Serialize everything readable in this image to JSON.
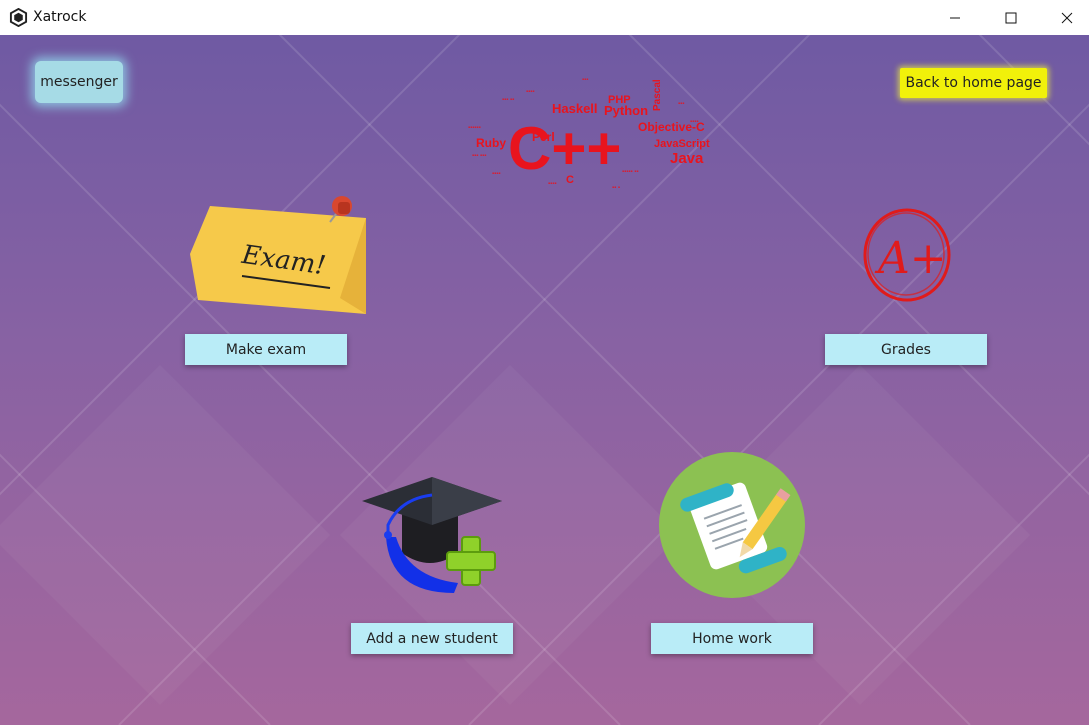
{
  "window": {
    "title": "Xatrock",
    "minimize_icon": "minimize-icon",
    "maximize_icon": "maximize-icon",
    "close_icon": "close-icon"
  },
  "nav": {
    "messenger_label": "messenger",
    "home_label": "Back to home page"
  },
  "cards": [
    {
      "label": "Make exam",
      "icon": "exam-note-icon",
      "note_text": "Exam!"
    },
    {
      "label": "Grades",
      "icon": "grade-a-plus-icon",
      "grade_text": "A+"
    },
    {
      "label": "Add a new student",
      "icon": "graduation-cap-plus-icon"
    },
    {
      "label": "Home work",
      "icon": "homework-scroll-icon"
    }
  ],
  "word_cloud": {
    "main": "C++",
    "words": [
      "Haskell",
      "PHP",
      "Python",
      "Perl",
      "Ruby",
      "Objective-C",
      "JavaScript",
      "Java",
      "Pascal",
      "C"
    ]
  },
  "colors": {
    "button_bg": "#b9ecf7",
    "home_button_bg": "#f1f10a",
    "word_cloud": "#e8141e"
  }
}
